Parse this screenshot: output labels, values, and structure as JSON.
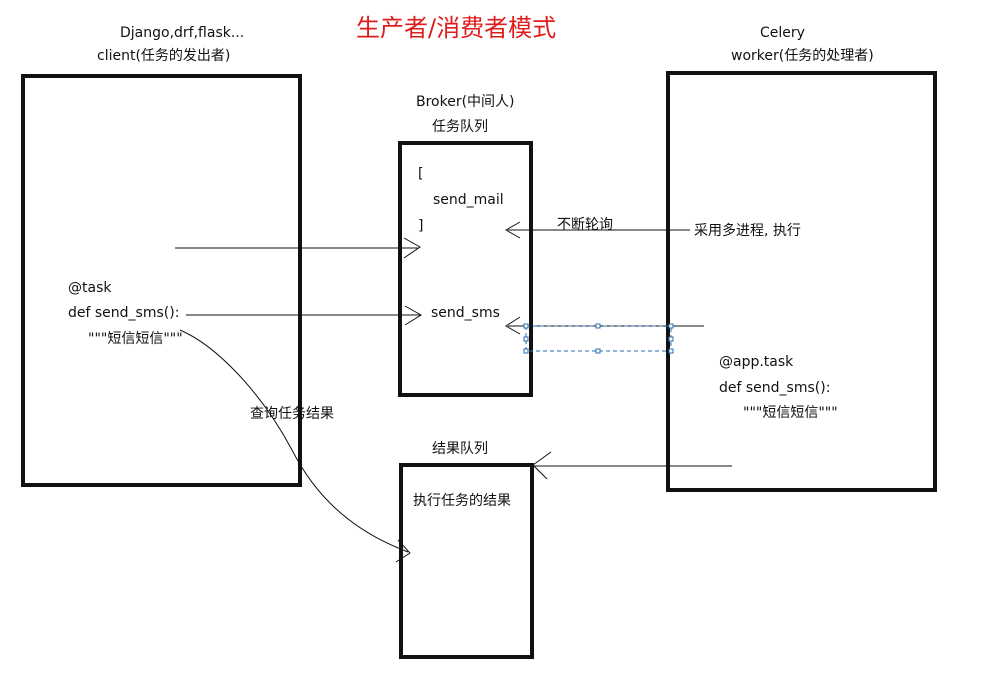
{
  "title": "生产者/消费者模式",
  "client": {
    "frameworks": "Django,drf,flask...",
    "label": "client(任务的发出者)",
    "decorator": "@task",
    "def_line": "def send_sms():",
    "docstring": "\"\"\"短信短信\"\"\""
  },
  "broker": {
    "label": "Broker(中间人)",
    "queue_label": "任务队列",
    "open_bracket": "[",
    "item_mail": "send_mail",
    "close_bracket": "]",
    "item_sms": "send_sms"
  },
  "worker": {
    "name": "Celery",
    "label": "worker(任务的处理者)",
    "decorator": "@app.task",
    "def_line": "def send_sms():",
    "docstring": "\"\"\"短信短信\"\"\""
  },
  "result": {
    "queue_label": "结果队列",
    "content": "执行任务的结果"
  },
  "annotations": {
    "polling": "不断轮询",
    "multiprocess": "采用多进程, 执行",
    "query": "查询任务结果"
  },
  "colors": {
    "title": "#e01b1b",
    "ink": "#111111",
    "selection": "#2a6db0"
  }
}
